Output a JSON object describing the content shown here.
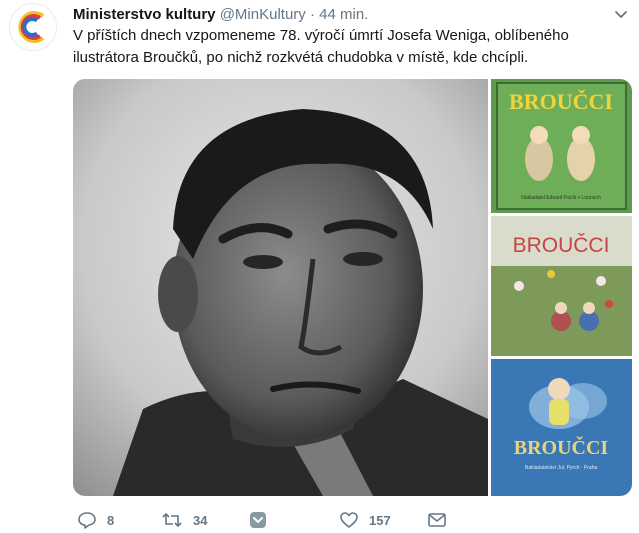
{
  "tweet": {
    "author_name": "Ministerstvo kultury",
    "handle": "@MinKultury",
    "separator": "·",
    "time": "44 min.",
    "text": "V příštích dnech vzpomeneme 78. výročí úmrtí Josefa Weniga, oblíbeného ilustrátora Broučků, po nichž rozkvétá chudobka v místě, kde chcípli."
  },
  "media": {
    "thumb1_title": "BROUČCI",
    "thumb1_caption": "Nakladatel Eduard Pacík v Lounech",
    "thumb2_title": "BROUČCI",
    "thumb3_title": "BROUČCI",
    "thumb3_caption": "Nakladatelství Jul. Pyrch · Praha"
  },
  "actions": {
    "reply_count": "8",
    "retweet_count": "34",
    "like_count": "157"
  },
  "colors": {
    "text": "#14171a",
    "secondary": "#657786",
    "thumb1_bg": "#5d9a4f",
    "thumb2_bg": "#7e9a5a",
    "thumb3_bg": "#3a78b5"
  }
}
